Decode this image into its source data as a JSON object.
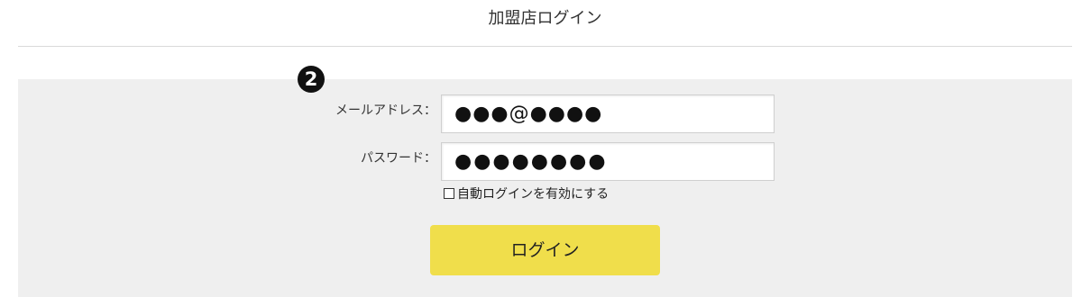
{
  "header": {
    "title": "加盟店ログイン"
  },
  "step_marker": "2",
  "form": {
    "email": {
      "label": "メールアドレス：",
      "value": "●●●@●●●●"
    },
    "password": {
      "label": "パスワード：",
      "value": "●●●●●●●●"
    },
    "remember": {
      "label": "自動ログインを有効にする",
      "checked": false
    },
    "submit_label": "ログイン"
  },
  "colors": {
    "panel_background": "#efefef",
    "button_background": "#f0de4b",
    "header_divider": "#d9d9d9"
  }
}
